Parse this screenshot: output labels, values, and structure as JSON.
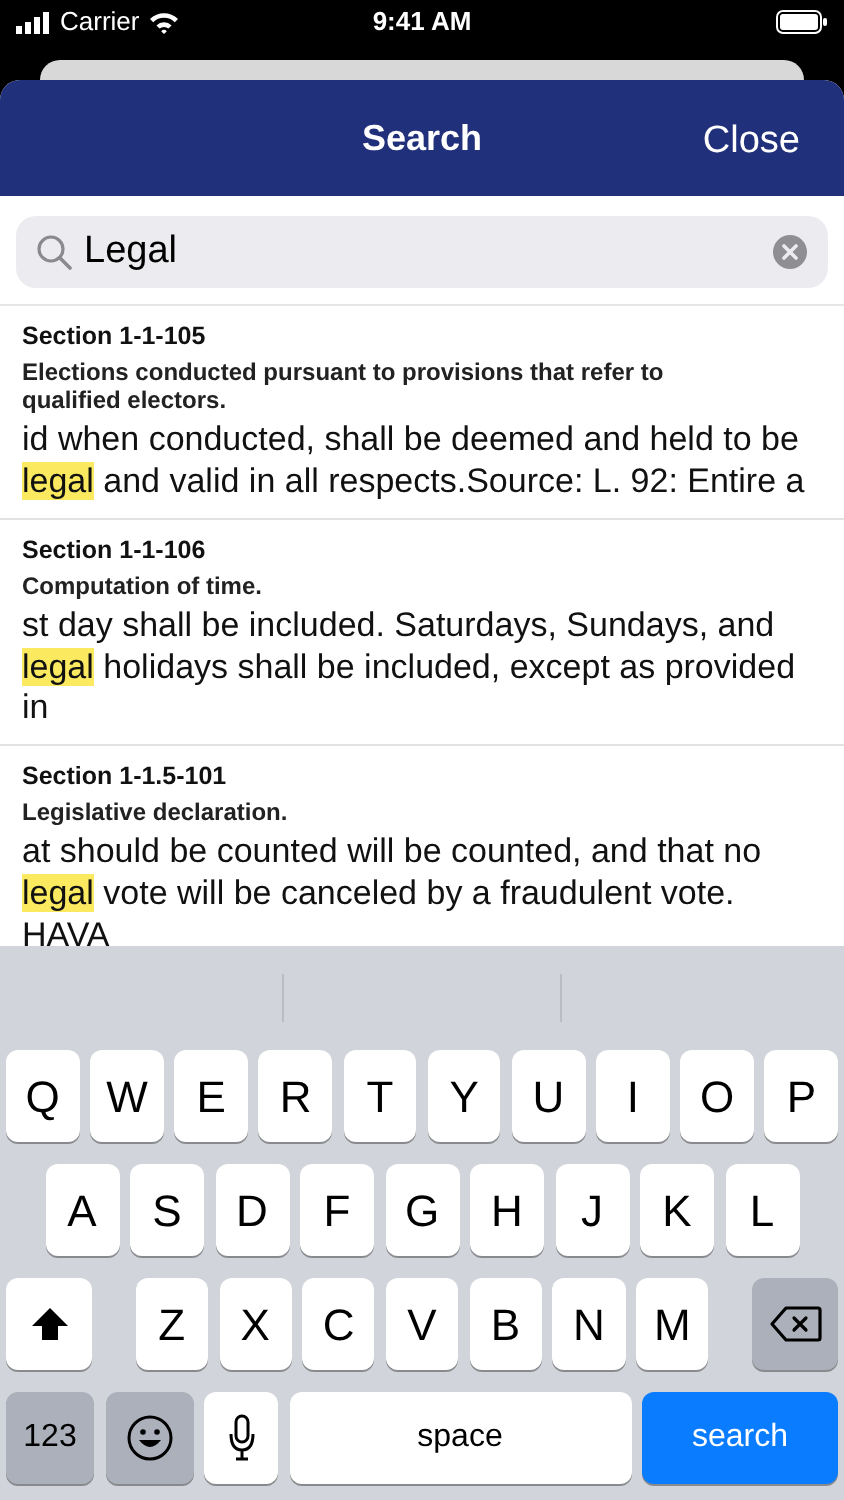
{
  "status_bar": {
    "carrier": "Carrier",
    "time": "9:41 AM"
  },
  "header": {
    "title": "Search",
    "close": "Close"
  },
  "search": {
    "value": "Legal"
  },
  "results": [
    {
      "section": "Section 1-1-105",
      "heading": "Elections conducted pursuant to provisions that refer to qualified electors.",
      "before": "id when conducted, shall be deemed and held to be ",
      "match": "legal",
      "after": " and valid in all respects.Source: L. 92: Entire a"
    },
    {
      "section": "Section 1-1-106",
      "heading": "Computation of time.",
      "before": "st day shall be included. Saturdays, Sundays, and ",
      "match": "legal",
      "after": " holidays shall be included, except as provided in"
    },
    {
      "section": "Section 1-1.5-101",
      "heading": "Legislative declaration.",
      "before": "at should be counted will be counted, and that no ",
      "match": "legal",
      "after": " vote will be canceled by a fraudulent vote. HAVA"
    }
  ],
  "keyboard": {
    "rows": [
      {
        "keys": [
          {
            "kind": "letter",
            "label": "Q"
          },
          {
            "kind": "letter",
            "label": "W"
          },
          {
            "kind": "letter",
            "label": "E"
          },
          {
            "kind": "letter",
            "label": "R"
          },
          {
            "kind": "letter",
            "label": "T"
          },
          {
            "kind": "letter",
            "label": "Y"
          },
          {
            "kind": "letter",
            "label": "U"
          },
          {
            "kind": "letter",
            "label": "I"
          },
          {
            "kind": "letter",
            "label": "O"
          },
          {
            "kind": "letter",
            "label": "P"
          }
        ]
      },
      {
        "keys": [
          {
            "kind": "letter",
            "label": "A"
          },
          {
            "kind": "letter",
            "label": "S"
          },
          {
            "kind": "letter",
            "label": "D"
          },
          {
            "kind": "letter",
            "label": "F"
          },
          {
            "kind": "letter",
            "label": "G"
          },
          {
            "kind": "letter",
            "label": "H"
          },
          {
            "kind": "letter",
            "label": "J"
          },
          {
            "kind": "letter",
            "label": "K"
          },
          {
            "kind": "letter",
            "label": "L"
          }
        ]
      },
      {
        "keys": [
          {
            "kind": "shift"
          },
          {
            "kind": "letter",
            "label": "Z"
          },
          {
            "kind": "letter",
            "label": "X"
          },
          {
            "kind": "letter",
            "label": "C"
          },
          {
            "kind": "letter",
            "label": "V"
          },
          {
            "kind": "letter",
            "label": "B"
          },
          {
            "kind": "letter",
            "label": "N"
          },
          {
            "kind": "letter",
            "label": "M"
          },
          {
            "kind": "delete"
          }
        ]
      }
    ],
    "bottom_row": {
      "numbers": "123",
      "space": "space",
      "action": "search"
    }
  }
}
